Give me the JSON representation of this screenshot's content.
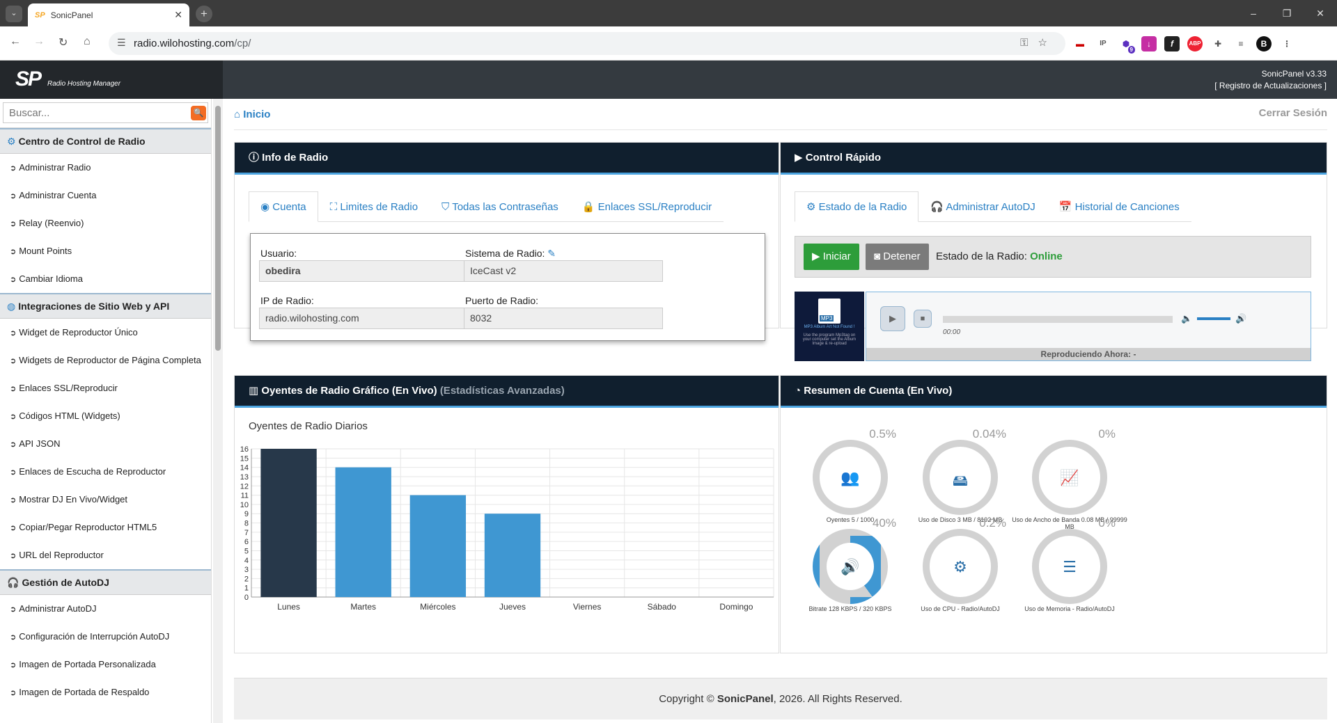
{
  "browser": {
    "tab_title": "SonicPanel",
    "url_host": "radio.wilohosting.com",
    "url_path": "/cp/",
    "ext_badge": "9"
  },
  "header": {
    "logo": "SP",
    "tagline": "Radio Hosting Manager",
    "version": "SonicPanel v3.33",
    "changelog": "[ Registro de Actualizaciones ]"
  },
  "sidebar": {
    "search_placeholder": "Buscar...",
    "sections": [
      {
        "title": "Centro de Control de Radio",
        "items": [
          "Administrar Radio",
          "Administrar Cuenta",
          "Relay (Reenvio)",
          "Mount Points",
          "Cambiar Idioma"
        ]
      },
      {
        "title": "Integraciones de Sitio Web y API",
        "items": [
          "Widget de Reproductor Único",
          "Widgets de Reproductor de Página Completa",
          "Enlaces SSL/Reproducir",
          "Códigos HTML (Widgets)",
          "API JSON",
          "Enlaces de Escucha de Reproductor",
          "Mostrar DJ En Vivo/Widget",
          "Copiar/Pegar Reproductor HTML5",
          "URL del Reproductor"
        ]
      },
      {
        "title": "Gestión de AutoDJ",
        "items": [
          "Administrar AutoDJ",
          "Configuración de Interrupción AutoDJ",
          "Imagen de Portada Personalizada",
          "Imagen de Portada de Respaldo"
        ]
      }
    ]
  },
  "main": {
    "breadcrumb": "Inicio",
    "logout": "Cerrar Sesión"
  },
  "info": {
    "title": "Info de Radio",
    "tabs": [
      "Cuenta",
      "Limites de Radio",
      "Todas las Contraseñas",
      "Enlaces SSL/Reproducir"
    ],
    "user_label": "Usuario:",
    "user_value": "obedira",
    "system_label": "Sistema de Radio:",
    "system_value": "IceCast v2",
    "ip_label": "IP de Radio:",
    "ip_value": "radio.wilohosting.com",
    "port_label": "Puerto de Radio:",
    "port_value": "8032"
  },
  "quick": {
    "title": "Control Rápido",
    "tabs": [
      "Estado de la Radio",
      "Administrar AutoDJ",
      "Historial de Canciones"
    ],
    "start": "Iniciar",
    "stop": "Detener",
    "status_label": "Estado de la Radio:",
    "status_value": "Online",
    "art_label": "MP3",
    "art_text": "MP3 Album Art Not Found !",
    "art_sub": "Use the program Mp3tag on your computer set the Album Image & re-upload",
    "time": "00:00",
    "now_playing": "Reproduciendo Ahora: -"
  },
  "listeners": {
    "title": "Oyentes de Radio Gráfico (En Vivo)",
    "subtitle": "(Estadísticas Avanzadas)",
    "chart_title": "Oyentes de Radio Diarios"
  },
  "chart_data": {
    "type": "bar",
    "categories": [
      "Lunes",
      "Martes",
      "Miércoles",
      "Jueves",
      "Viernes",
      "Sábado",
      "Domingo"
    ],
    "values": [
      16,
      14,
      11,
      9,
      0,
      0,
      0
    ],
    "ylim": [
      0,
      16
    ],
    "yticks": [
      0,
      1,
      2,
      3,
      4,
      5,
      6,
      7,
      8,
      9,
      10,
      11,
      12,
      13,
      14,
      15,
      16
    ],
    "grid": true,
    "colors": [
      "#27384a",
      "#3f97d2",
      "#3f97d2",
      "#3f97d2",
      "#3f97d2",
      "#3f97d2",
      "#3f97d2"
    ]
  },
  "summary": {
    "title": "Resumen de Cuenta (En Vivo)",
    "dials": [
      {
        "pct": "0.5%",
        "label": "Oyentes 5 / 1000",
        "icon": "users-icon",
        "glyph": "👥",
        "fraction": 0.005
      },
      {
        "pct": "0.04%",
        "label": "Uso de Disco 3 MB / 8192 MB",
        "icon": "hdd-icon",
        "glyph": "🖴",
        "fraction": 0.0004
      },
      {
        "pct": "0%",
        "label": "Uso de Ancho de Banda 0.08 MB / 99999 MB",
        "icon": "chart-line-icon",
        "glyph": "📈",
        "fraction": 0
      },
      {
        "pct": "40%",
        "label": "Bitrate 128 KBPS / 320 KBPS",
        "icon": "volume-icon",
        "glyph": "🔊",
        "fraction": 0.4
      },
      {
        "pct": "0.2%",
        "label": "Uso de CPU - Radio/AutoDJ",
        "icon": "gear-icon",
        "glyph": "⚙",
        "fraction": 0.002
      },
      {
        "pct": "0%",
        "label": "Uso de Memoria - Radio/AutoDJ",
        "icon": "server-icon",
        "glyph": "☰",
        "fraction": 0
      }
    ]
  },
  "footer": {
    "prefix": "Copyright © ",
    "brand": "SonicPanel",
    "suffix": ", 2026. All Rights Reserved."
  }
}
